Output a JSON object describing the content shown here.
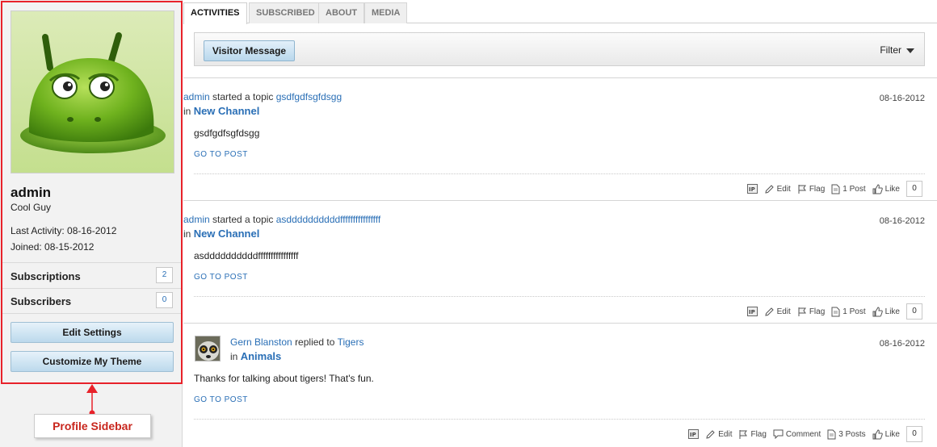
{
  "sidebar": {
    "name": "admin",
    "user_title": "Cool Guy",
    "last_activity": "Last Activity: 08-16-2012",
    "joined": "Joined: 08-15-2012",
    "subscriptions_label": "Subscriptions",
    "subscriptions_count": "2",
    "subscribers_label": "Subscribers",
    "subscribers_count": "0",
    "edit_settings_label": "Edit Settings",
    "customize_theme_label": "Customize My Theme"
  },
  "callout": {
    "label": "Profile Sidebar",
    "color": "#c8261d"
  },
  "tabs": [
    {
      "label": "ACTIVITIES"
    },
    {
      "label": "SUBSCRIBED"
    },
    {
      "label": "ABOUT"
    },
    {
      "label": "MEDIA"
    }
  ],
  "toolbar": {
    "visitor_message_label": "Visitor Message",
    "filter_label": "Filter"
  },
  "activities": [
    {
      "author": "admin",
      "verb": "started a topic",
      "topic": "gsdfgdfsgfdsgg",
      "in_label": "in",
      "channel": "New Channel",
      "date": "08-16-2012",
      "body": "gsdfgdfsgfdsgg",
      "goto_label": "GO TO POST",
      "edit_label": "Edit",
      "flag_label": "Flag",
      "posts_label": "1 Post",
      "like_label": "Like",
      "like_count": "0"
    },
    {
      "author": "admin",
      "verb": "started a topic",
      "topic": "asddddddddddffffffffffffffff",
      "in_label": "in",
      "channel": "New Channel",
      "date": "08-16-2012",
      "body": "asddddddddddffffffffffffffff",
      "goto_label": "GO TO POST",
      "edit_label": "Edit",
      "flag_label": "Flag",
      "posts_label": "1 Post",
      "like_label": "Like",
      "like_count": "0"
    },
    {
      "author": "Gern Blanston",
      "verb": "replied to",
      "topic": "Tigers",
      "in_label": "in",
      "channel": "Animals",
      "date": "08-16-2012",
      "body": "Thanks for talking about tigers! That's fun.",
      "goto_label": "GO TO POST",
      "edit_label": "Edit",
      "flag_label": "Flag",
      "comment_label": "Comment",
      "posts_label": "3 Posts",
      "like_label": "Like",
      "like_count": "0"
    }
  ],
  "colors": {
    "link": "#2a6fb6",
    "highlight_border": "#e8222a"
  }
}
